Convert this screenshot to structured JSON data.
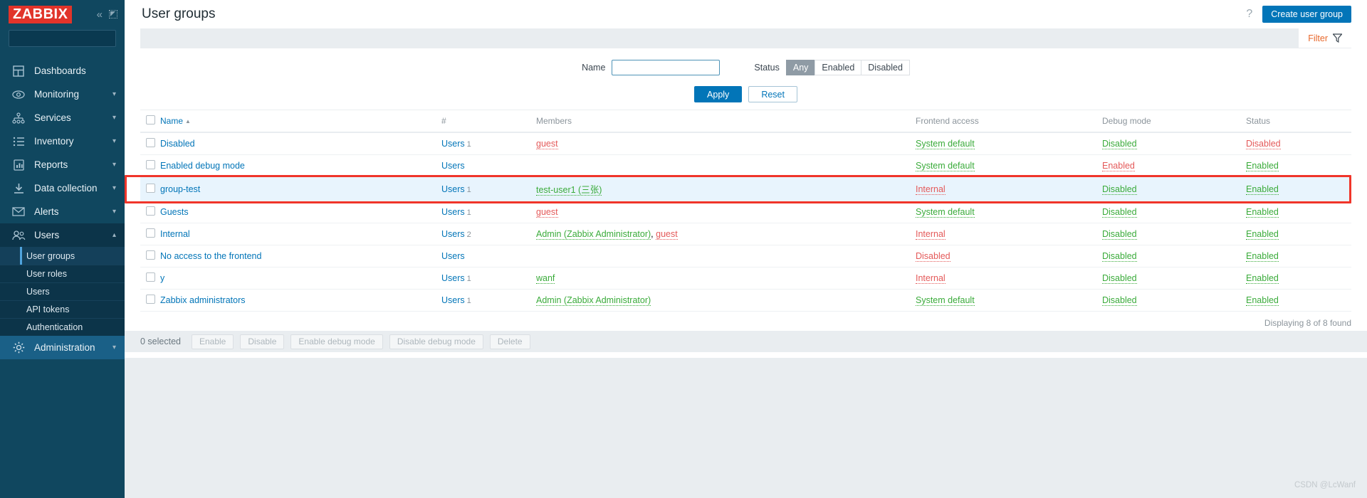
{
  "brand": {
    "logo_text": "ZABBIX"
  },
  "sidebar": {
    "search_placeholder": "",
    "search_value": "",
    "collapse_icon": "chevron-double-left-icon",
    "compact_icon": "compact-view-icon",
    "items": [
      {
        "label": "Dashboards",
        "icon": "dashboard-icon",
        "has_chevron": false
      },
      {
        "label": "Monitoring",
        "icon": "eye-icon",
        "has_chevron": true
      },
      {
        "label": "Services",
        "icon": "services-tree-icon",
        "has_chevron": true
      },
      {
        "label": "Inventory",
        "icon": "list-icon",
        "has_chevron": true
      },
      {
        "label": "Reports",
        "icon": "report-chart-icon",
        "has_chevron": true
      },
      {
        "label": "Data collection",
        "icon": "download-icon",
        "has_chevron": true
      },
      {
        "label": "Alerts",
        "icon": "envelope-icon",
        "has_chevron": true
      },
      {
        "label": "Users",
        "icon": "users-icon",
        "has_chevron": true
      }
    ],
    "users_submenu": [
      {
        "label": "User groups",
        "current": true
      },
      {
        "label": "User roles",
        "current": false
      },
      {
        "label": "Users",
        "current": false
      },
      {
        "label": "API tokens",
        "current": false
      },
      {
        "label": "Authentication",
        "current": false
      }
    ],
    "administration": {
      "label": "Administration",
      "icon": "gear-icon",
      "has_chevron": true
    }
  },
  "header": {
    "title": "User groups",
    "help_icon": "question-mark-icon",
    "create_button": "Create user group"
  },
  "filter": {
    "tab_label": "Filter",
    "tab_icon": "funnel-icon",
    "name_label": "Name",
    "name_value": "",
    "name_placeholder": "",
    "status_label": "Status",
    "status_options": [
      "Any",
      "Enabled",
      "Disabled"
    ],
    "status_selected": "Any",
    "apply_label": "Apply",
    "reset_label": "Reset"
  },
  "table": {
    "columns": [
      "Name",
      "#",
      "Members",
      "Frontend access",
      "Debug mode",
      "Status"
    ],
    "sort_column": "Name",
    "sort_direction": "asc",
    "sort_arrow": "▲",
    "rows": [
      {
        "name": "Disabled",
        "users_link": "Users",
        "users_count": "1",
        "members": [
          {
            "text": "guest",
            "color": "red"
          }
        ],
        "frontend_access": "System default",
        "frontend_access_color": "green",
        "debug_mode": "Disabled",
        "debug_mode_color": "green",
        "status": "Disabled",
        "status_color": "red",
        "highlighted": false
      },
      {
        "name": "Enabled debug mode",
        "users_link": "Users",
        "users_count": "",
        "members": [],
        "frontend_access": "System default",
        "frontend_access_color": "green",
        "debug_mode": "Enabled",
        "debug_mode_color": "red",
        "status": "Enabled",
        "status_color": "green",
        "highlighted": false
      },
      {
        "name": "group-test",
        "users_link": "Users",
        "users_count": "1",
        "members": [
          {
            "text": "test-user1 (三张)",
            "color": "green"
          }
        ],
        "frontend_access": "Internal",
        "frontend_access_color": "red",
        "debug_mode": "Disabled",
        "debug_mode_color": "green",
        "status": "Enabled",
        "status_color": "green",
        "highlighted": true
      },
      {
        "name": "Guests",
        "users_link": "Users",
        "users_count": "1",
        "members": [
          {
            "text": "guest",
            "color": "red"
          }
        ],
        "frontend_access": "System default",
        "frontend_access_color": "green",
        "debug_mode": "Disabled",
        "debug_mode_color": "green",
        "status": "Enabled",
        "status_color": "green",
        "highlighted": false
      },
      {
        "name": "Internal",
        "users_link": "Users",
        "users_count": "2",
        "members": [
          {
            "text": "Admin (Zabbix Administrator)",
            "color": "green"
          },
          {
            "text": "guest",
            "color": "red"
          }
        ],
        "frontend_access": "Internal",
        "frontend_access_color": "red",
        "debug_mode": "Disabled",
        "debug_mode_color": "green",
        "status": "Enabled",
        "status_color": "green",
        "highlighted": false
      },
      {
        "name": "No access to the frontend",
        "users_link": "Users",
        "users_count": "",
        "members": [],
        "frontend_access": "Disabled",
        "frontend_access_color": "red",
        "debug_mode": "Disabled",
        "debug_mode_color": "green",
        "status": "Enabled",
        "status_color": "green",
        "highlighted": false
      },
      {
        "name": "y",
        "users_link": "Users",
        "users_count": "1",
        "members": [
          {
            "text": "wanf",
            "color": "green"
          }
        ],
        "frontend_access": "Internal",
        "frontend_access_color": "red",
        "debug_mode": "Disabled",
        "debug_mode_color": "green",
        "status": "Enabled",
        "status_color": "green",
        "highlighted": false
      },
      {
        "name": "Zabbix administrators",
        "users_link": "Users",
        "users_count": "1",
        "members": [
          {
            "text": "Admin (Zabbix Administrator)",
            "color": "green"
          }
        ],
        "frontend_access": "System default",
        "frontend_access_color": "green",
        "debug_mode": "Disabled",
        "debug_mode_color": "green",
        "status": "Enabled",
        "status_color": "green",
        "highlighted": false
      }
    ],
    "displaying": "Displaying 8 of 8 found"
  },
  "footer": {
    "selected_text": "0 selected",
    "actions": [
      "Enable",
      "Disable",
      "Enable debug mode",
      "Disable debug mode",
      "Delete"
    ]
  },
  "watermark": "CSDN @LcWanf",
  "colors": {
    "brand_red": "#e1342a",
    "sidebar_bg": "#10475f",
    "accent_blue": "#0275b8",
    "link_blue": "#0275b8",
    "green": "#3aab3a",
    "red": "#e45959",
    "orange": "#e8682c",
    "highlight_box": "#f0352a",
    "row_highlight": "#e8f4fd"
  }
}
